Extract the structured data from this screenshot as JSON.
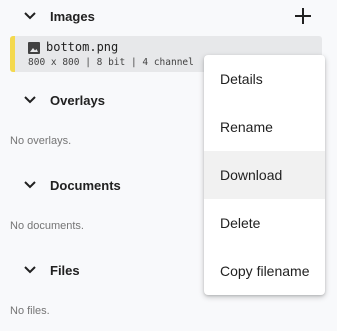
{
  "sections": {
    "images": {
      "title": "Images",
      "add_icon": "plus-icon"
    },
    "overlays": {
      "title": "Overlays",
      "empty": "No overlays."
    },
    "documents": {
      "title": "Documents",
      "empty": "No documents."
    },
    "files": {
      "title": "Files",
      "empty": "No files."
    }
  },
  "image_item": {
    "icon": "image-icon",
    "filename": "bottom.png",
    "meta": "800 x 800 | 8 bit | 4 channel",
    "accent_color": "#f4d94e"
  },
  "context_menu": {
    "items": [
      {
        "label": "Details"
      },
      {
        "label": "Rename"
      },
      {
        "label": "Download"
      },
      {
        "label": "Delete"
      },
      {
        "label": "Copy filename"
      }
    ],
    "highlighted": "Download"
  }
}
